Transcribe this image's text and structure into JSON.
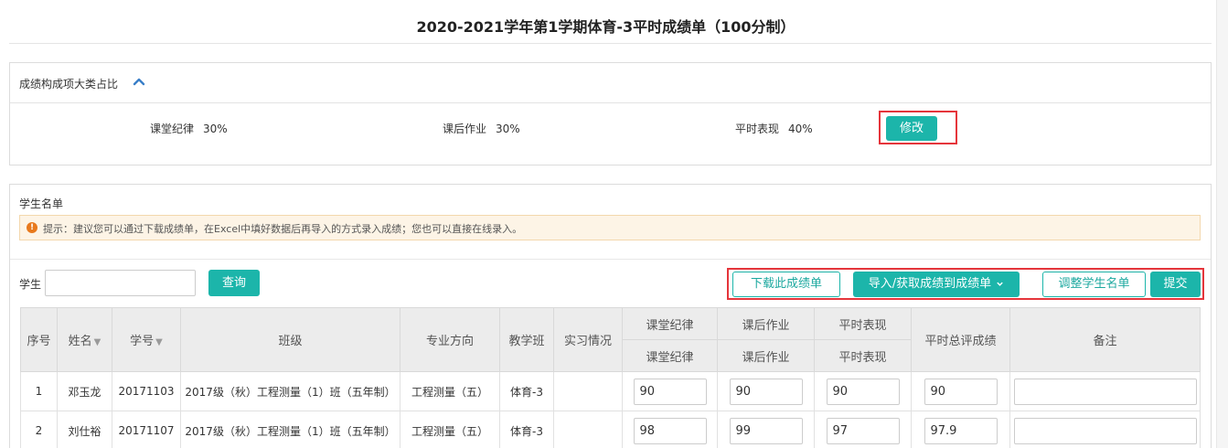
{
  "page": {
    "title": "2020-2021学年第1学期体育-3平时成绩单（100分制）"
  },
  "weights": {
    "header": "成绩构成项大类占比",
    "items": [
      {
        "label": "课堂纪律",
        "value": "30%"
      },
      {
        "label": "课后作业",
        "value": "30%"
      },
      {
        "label": "平时表现",
        "value": "40%"
      }
    ],
    "modify_label": "修改"
  },
  "students": {
    "section_label": "学生名单",
    "notice": "提示：建议您可以通过下载成绩单，在Excel中填好数据后再导入的方式录入成绩；您也可以直接在线录入。",
    "search": {
      "label": "学生",
      "value": "",
      "button": "查询"
    },
    "actions": {
      "download": "下载此成绩单",
      "import": "导入/获取成绩到成绩单",
      "adjust": "调整学生名单",
      "submit": "提交"
    },
    "columns": {
      "seq": "序号",
      "name": "姓名",
      "id": "学号",
      "class": "班级",
      "major": "专业方向",
      "teach_class": "教学班",
      "internship": "实习情况",
      "total": "平时总评成绩",
      "remark": "备注"
    },
    "groups": [
      {
        "top": "课堂纪律",
        "sub": "课堂纪律"
      },
      {
        "top": "课后作业",
        "sub": "课后作业"
      },
      {
        "top": "平时表现",
        "sub": "平时表现"
      }
    ],
    "rows": [
      {
        "seq": "1",
        "name": "邓玉龙",
        "id": "20171103",
        "class": "2017级（秋）工程测量（1）班（五年制）",
        "major": "工程测量（五）",
        "teach_class": "体育-3",
        "internship": "",
        "s1": "90",
        "s2": "90",
        "s3": "90",
        "total": "90",
        "remark": ""
      },
      {
        "seq": "2",
        "name": "刘仕裕",
        "id": "20171107",
        "class": "2017级（秋）工程测量（1）班（五年制）",
        "major": "工程测量（五）",
        "teach_class": "体育-3",
        "internship": "",
        "s1": "98",
        "s2": "99",
        "s3": "97",
        "total": "97.9",
        "remark": ""
      }
    ]
  },
  "icons": {
    "collapse": "chevron-up-icon",
    "notice": "exclamation-circle-icon",
    "sort": "caret-down-icon",
    "dropdown": "chevron-down-icon"
  },
  "colors": {
    "accent": "#1cb5aa",
    "highlight_border": "#e5353b",
    "notice_bg": "#fdf4e6",
    "notice_icon": "#e8791d"
  }
}
